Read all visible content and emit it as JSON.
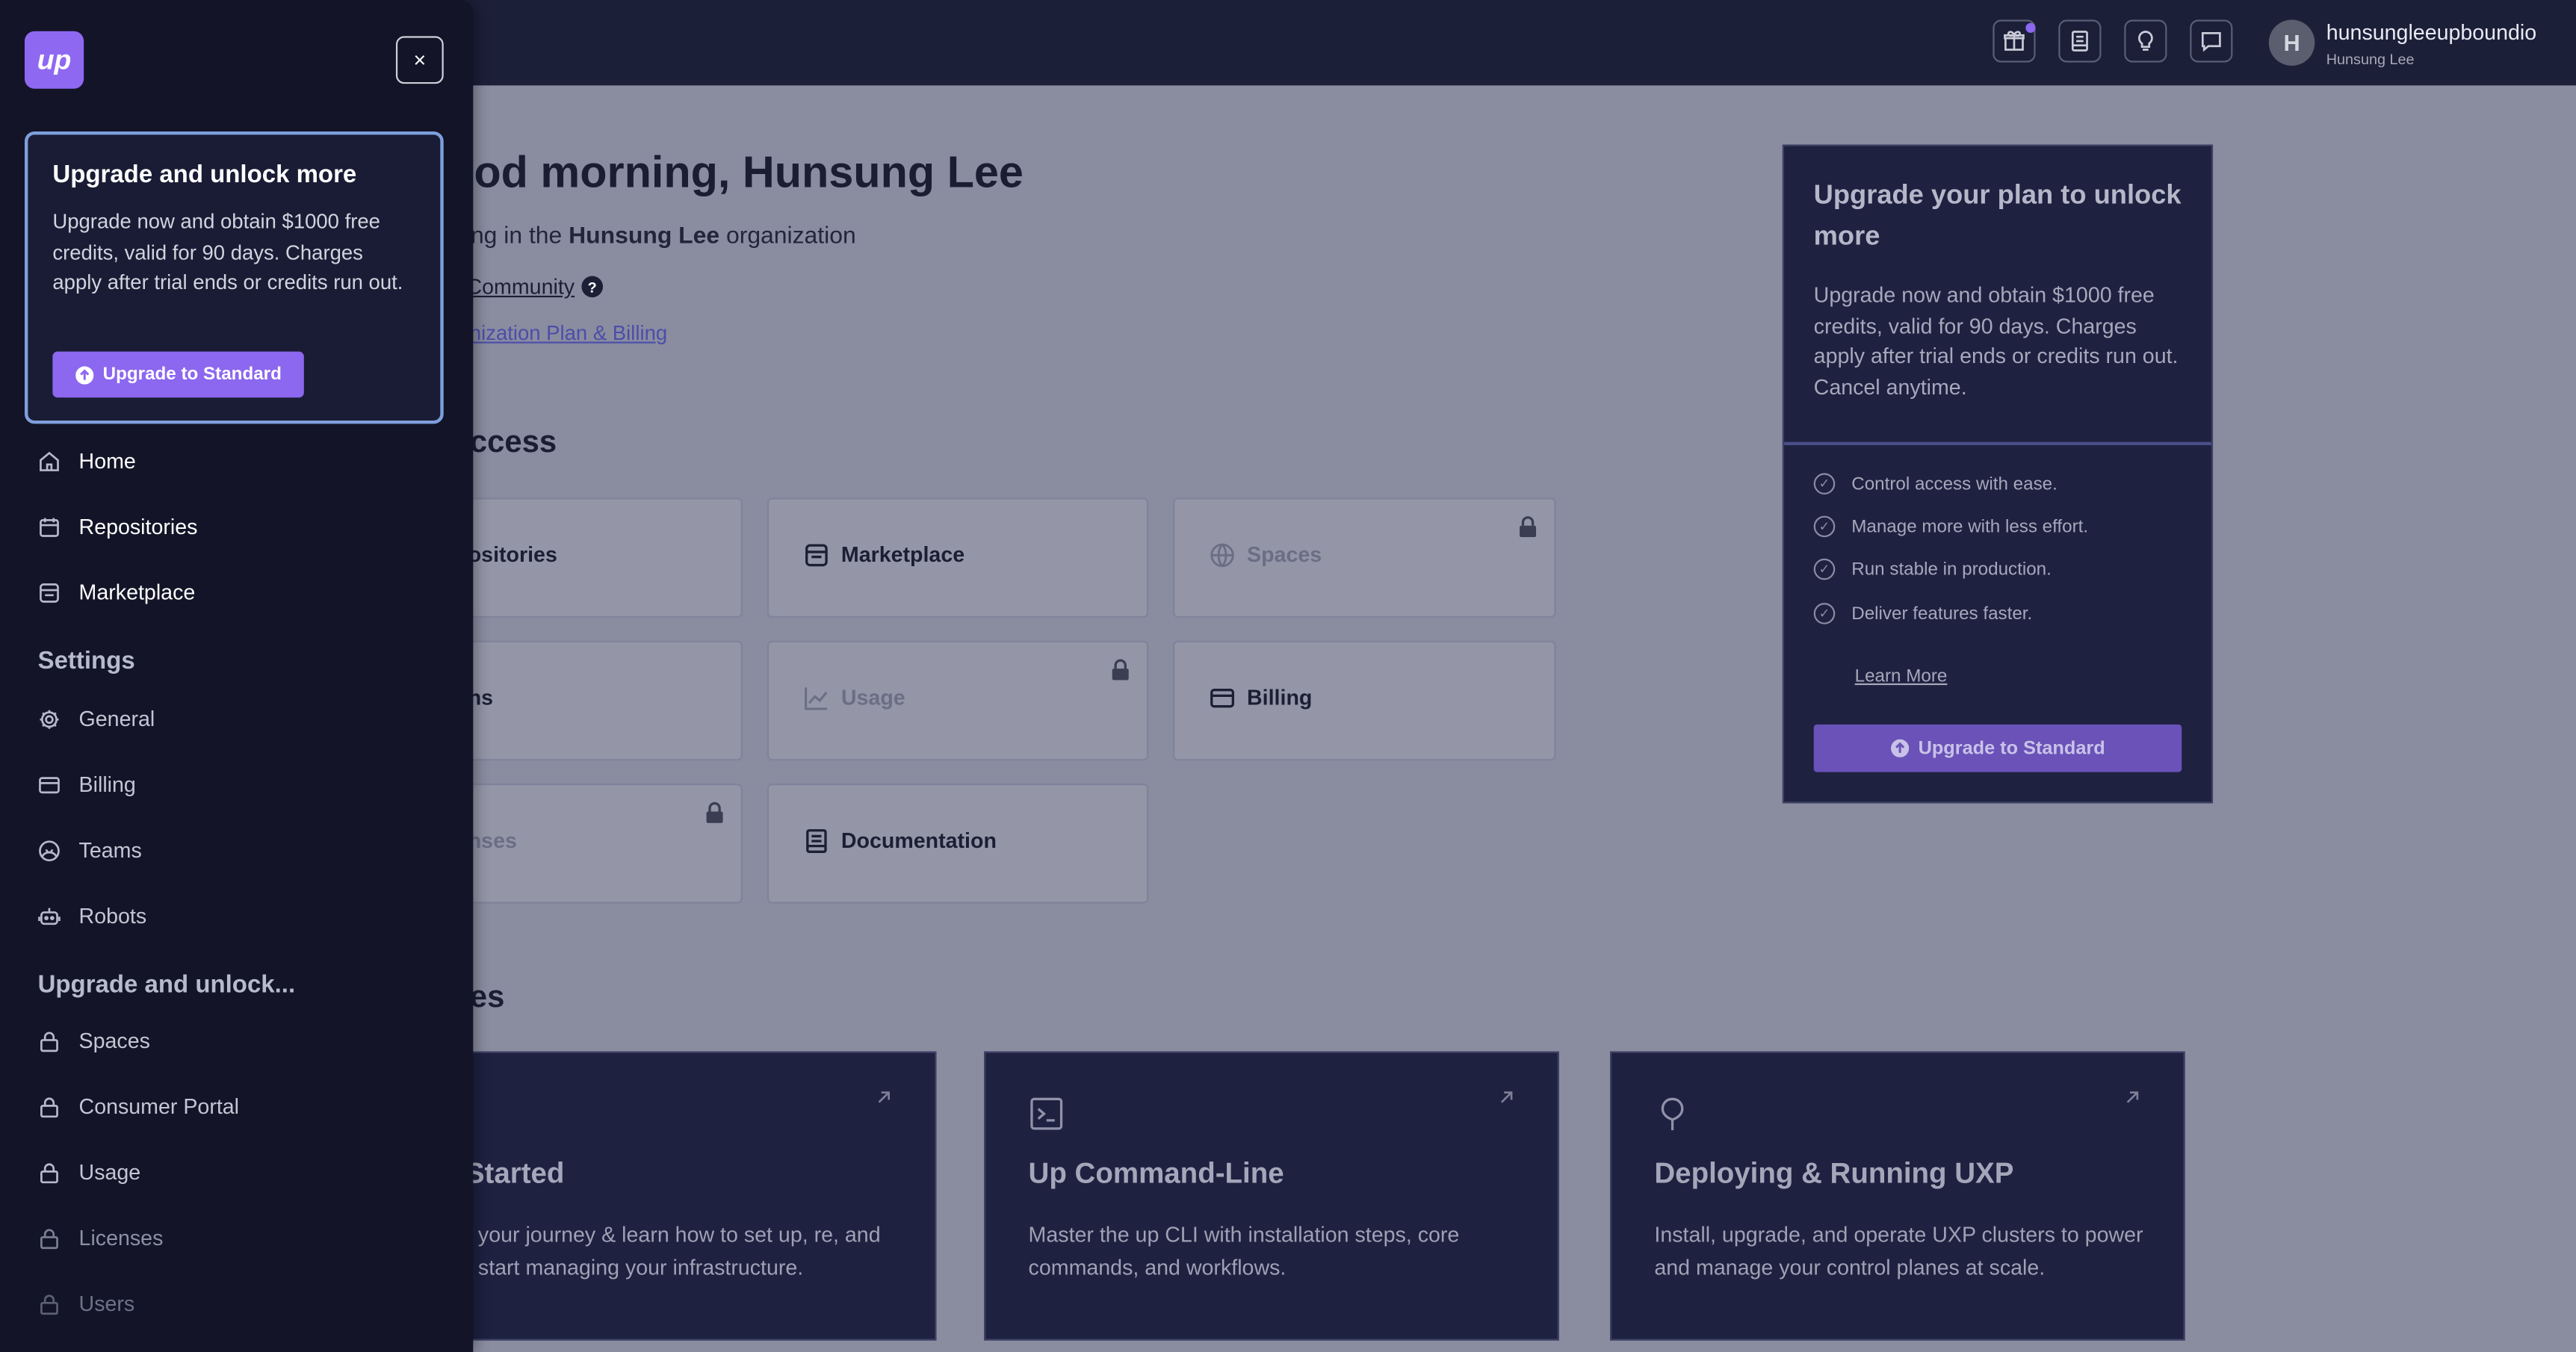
{
  "header": {
    "user_name": "hunsungleeupboundio",
    "user_sub": "Hunsung Lee",
    "avatar_initial": "H",
    "icons": [
      "gift-icon",
      "notebook-icon",
      "lightbulb-icon",
      "chat-icon"
    ]
  },
  "main": {
    "greeting": "ood morning, Hunsung Lee",
    "org_prefix": "king in the ",
    "org_name": "Hunsung Lee",
    "org_suffix": " organization",
    "community_link": "Community",
    "help_mark": "?",
    "plan_link": "anization Plan & Billing",
    "quick_access_title": "ccess",
    "quick_access": [
      {
        "label": "ositories",
        "icon": "box-icon",
        "locked": false
      },
      {
        "label": "Marketplace",
        "icon": "store-icon",
        "locked": false
      },
      {
        "label": "Spaces",
        "icon": "globe-icon",
        "locked": true
      },
      {
        "label": "ns",
        "icon": "",
        "locked": false
      },
      {
        "label": "Usage",
        "icon": "chart-icon",
        "locked": true
      },
      {
        "label": "Billing",
        "icon": "card-icon",
        "locked": false
      },
      {
        "label": "nses",
        "icon": "",
        "locked": true
      },
      {
        "label": "Documentation",
        "icon": "doc-icon",
        "locked": false
      }
    ],
    "guides_title": "es",
    "guides": [
      {
        "title": "ng Started",
        "desc": " your journey & learn how to set up, re, and start managing your infrastructure."
      },
      {
        "title": "Up Command-Line",
        "desc": "Master the up CLI with installation steps, core commands, and workflows."
      },
      {
        "title": "Deploying & Running UXP",
        "desc": "Install, upgrade, and operate UXP clusters to power and manage your control planes at scale."
      }
    ]
  },
  "upgrade_card": {
    "title": "Upgrade your plan to unlock more",
    "desc": "Upgrade now and obtain $1000 free credits, valid for 90 days. Charges apply after trial ends or credits run out. Cancel anytime.",
    "features": [
      "Control access with ease.",
      "Manage more with less effort.",
      "Run stable in production.",
      "Deliver features faster."
    ],
    "learn_more": "Learn More",
    "button": "Upgrade to Standard"
  },
  "drawer": {
    "logo": "up",
    "close": "×",
    "promo": {
      "title": "Upgrade and unlock more",
      "desc": "Upgrade now and obtain $1000 free credits, valid for 90 days. Charges apply after trial ends or credits run out.",
      "button": "Upgrade to Standard"
    },
    "nav": [
      "Home",
      "Repositories",
      "Marketplace"
    ],
    "settings_title": "Settings",
    "settings": [
      "General",
      "Billing",
      "Teams",
      "Robots"
    ],
    "upgrade_title": "Upgrade and unlock...",
    "locked": [
      "Spaces",
      "Consumer Portal",
      "Usage",
      "Licenses",
      "Users"
    ]
  },
  "colors": {
    "brand": "#8c67ef",
    "drawer_bg": "#131427",
    "topbar_bg": "#1c1f38",
    "overlay_bg": "#8a8ca0"
  }
}
